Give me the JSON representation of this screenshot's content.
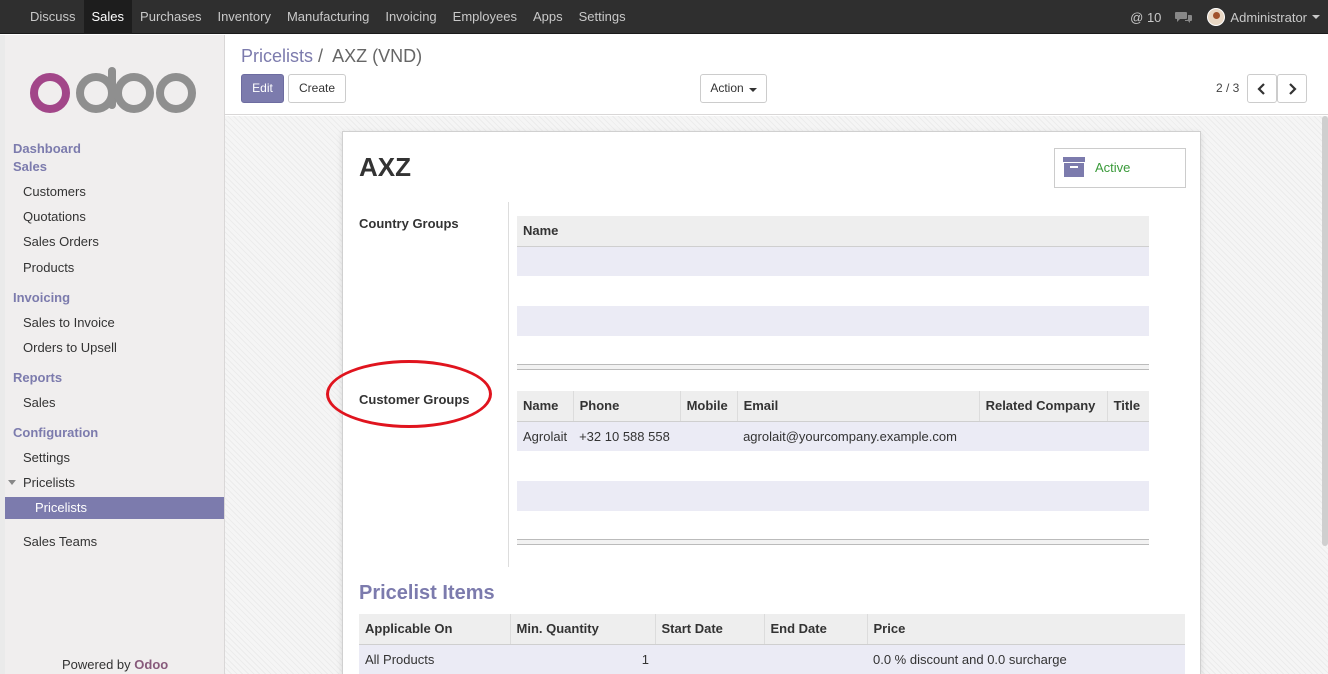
{
  "topbar": {
    "menu": [
      "Discuss",
      "Sales",
      "Purchases",
      "Inventory",
      "Manufacturing",
      "Invoicing",
      "Employees",
      "Apps",
      "Settings"
    ],
    "active_menu": "Sales",
    "mentions": "@ 10",
    "user": "Administrator"
  },
  "sidebar": {
    "logo_text": "odoo",
    "dashboard": "Dashboard",
    "sales_head": "Sales",
    "sales_items": [
      "Customers",
      "Quotations",
      "Sales Orders",
      "Products"
    ],
    "invoicing_head": "Invoicing",
    "invoicing_items": [
      "Sales to Invoice",
      "Orders to Upsell"
    ],
    "reports_head": "Reports",
    "reports_items": [
      "Sales"
    ],
    "config_head": "Configuration",
    "config_settings": "Settings",
    "config_pricelists": "Pricelists",
    "config_pricelists_sub": "Pricelists",
    "config_sales_teams": "Sales Teams",
    "powered_by": "Powered by",
    "powered_brand": "Odoo"
  },
  "control_panel": {
    "breadcrumb_parent": "Pricelists",
    "breadcrumb_sep": "/",
    "breadcrumb_current": "AXZ (VND)",
    "edit_label": "Edit",
    "create_label": "Create",
    "action_label": "Action",
    "pager": "2 / 3"
  },
  "form": {
    "name": "AXZ",
    "active_label": "Active",
    "country_groups_label": "Country Groups",
    "country_groups_columns": [
      "Name"
    ],
    "customer_groups_label": "Customer Groups",
    "customer_groups_columns": [
      "Name",
      "Phone",
      "Mobile",
      "Email",
      "Related Company",
      "Title"
    ],
    "customer_groups_rows": [
      {
        "name": "Agrolait",
        "phone": "+32 10 588 558",
        "mobile": "",
        "email": "agrolait@yourcompany.example.com",
        "company": "",
        "title": ""
      }
    ],
    "pricelist_items_title": "Pricelist Items",
    "pricelist_items_columns": [
      "Applicable On",
      "Min. Quantity",
      "Start Date",
      "End Date",
      "Price"
    ],
    "pricelist_items_rows": [
      {
        "applicable_on": "All Products",
        "min_qty": "1",
        "start": "",
        "end": "",
        "price": "0.0 % discount and 0.0 surcharge"
      }
    ]
  },
  "colors": {
    "accent": "#7c7bad",
    "topbar": "#2f2f2f",
    "annotation": "#e0141e",
    "active": "#3a9a3a"
  }
}
